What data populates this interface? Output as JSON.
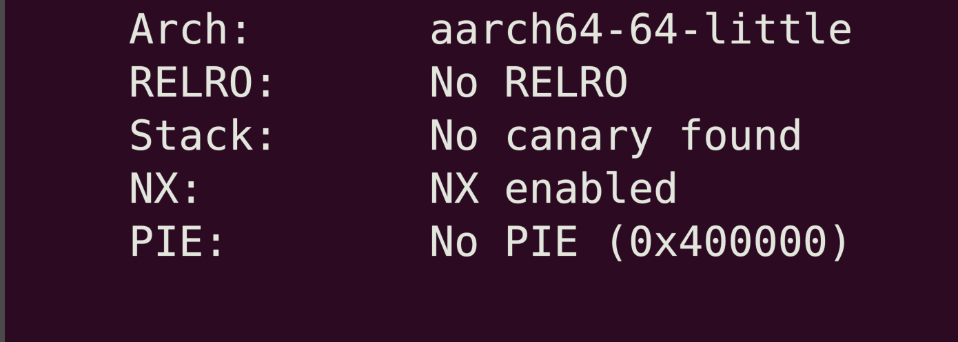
{
  "terminal": {
    "lines": [
      {
        "key": "Arch:",
        "value": "aarch64-64-little"
      },
      {
        "key": "RELRO:",
        "value": "No RELRO"
      },
      {
        "key": "Stack:",
        "value": "No canary found"
      },
      {
        "key": "NX:",
        "value": "NX enabled"
      },
      {
        "key": "PIE:",
        "value": "No PIE (0x400000)"
      }
    ],
    "colors": {
      "background": "#2c0a22",
      "text": "#e3e6dd",
      "left_border": "#4a4a4a"
    }
  }
}
